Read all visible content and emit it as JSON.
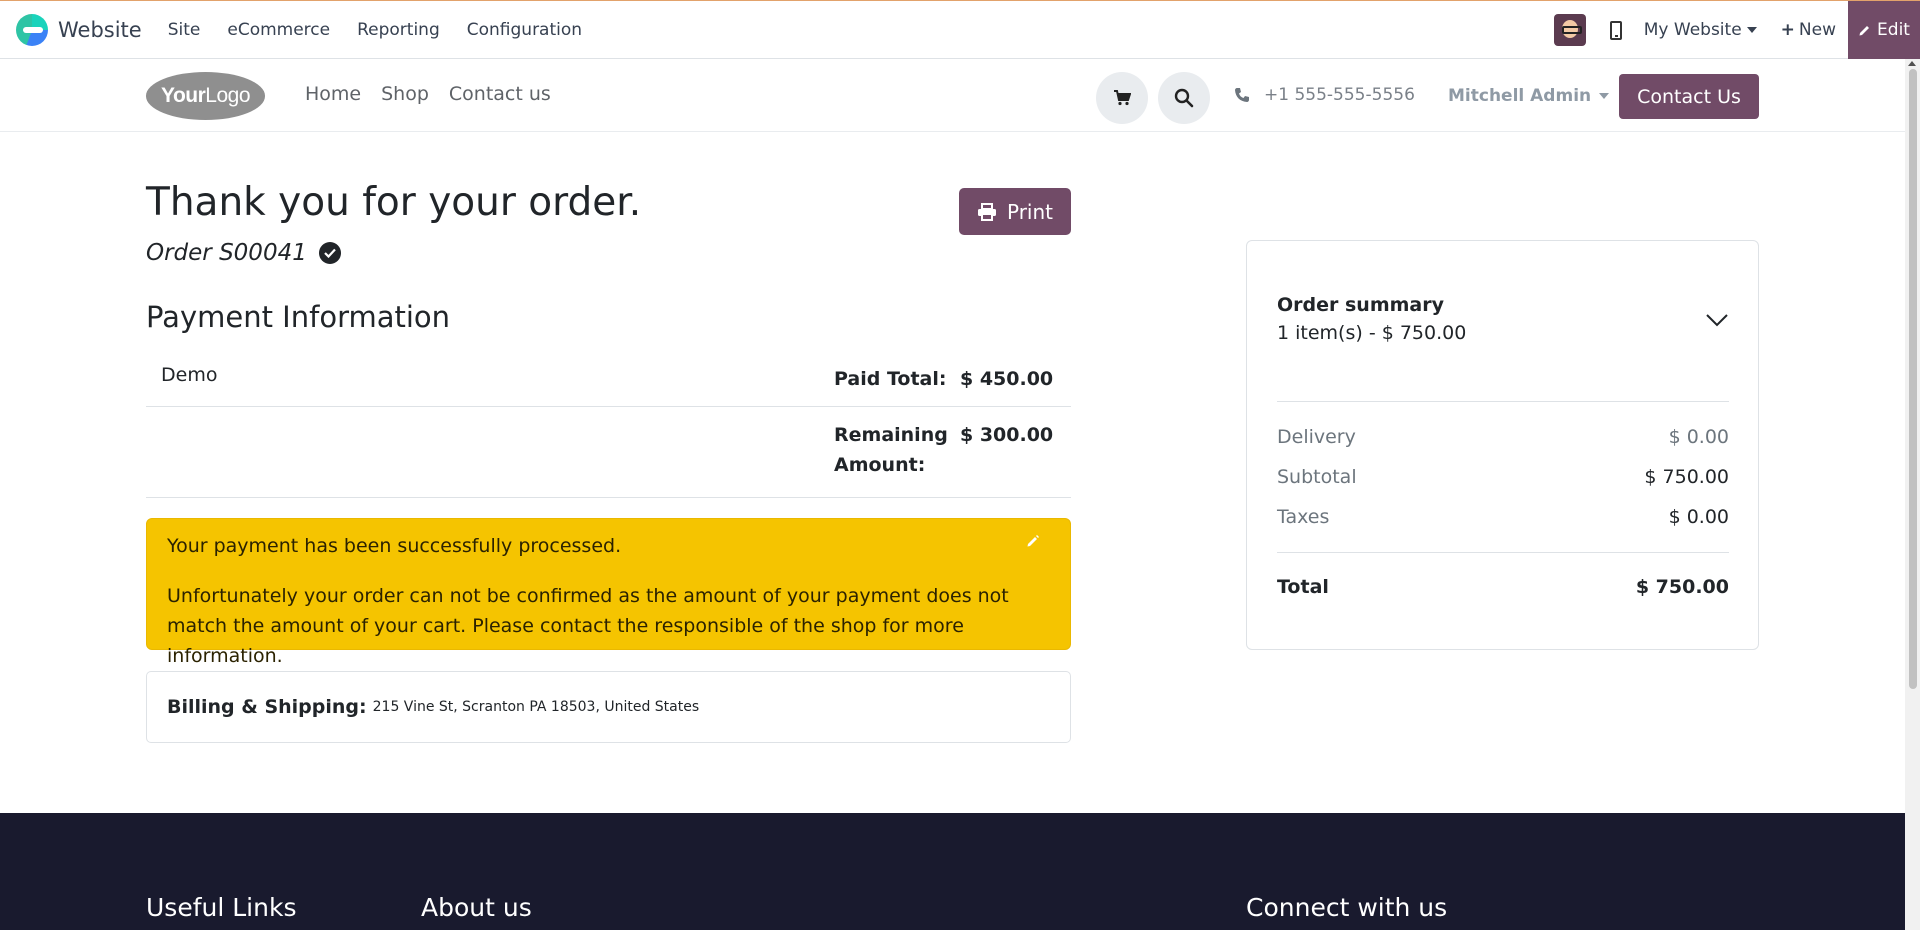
{
  "adminbar": {
    "app_name": "Website",
    "menu": [
      "Site",
      "eCommerce",
      "Reporting",
      "Configuration"
    ],
    "website_switcher": "My Website",
    "new_label": "New",
    "edit_label": "Edit"
  },
  "header": {
    "logo_text_bold": "Your",
    "logo_text_rest": "Logo",
    "nav": [
      "Home",
      "Shop",
      "Contact us"
    ],
    "phone": "+1 555-555-5556",
    "user": "Mitchell Admin",
    "contact_button": "Contact Us"
  },
  "main": {
    "title": "Thank you for your order.",
    "order_ref": "Order S00041",
    "print_label": "Print",
    "payment_heading": "Payment Information",
    "payments": [
      {
        "method": "Demo",
        "label": "Paid Total:",
        "amount": "$ 450.00"
      },
      {
        "method": "",
        "label": "Remaining Amount:",
        "amount": "$ 300.00"
      }
    ],
    "alert": {
      "line1": "Your payment has been successfully processed.",
      "line2": "Unfortunately your order can not be confirmed as the amount of your payment does not match the amount of your cart. Please contact the responsible of the shop for more information."
    },
    "billing": {
      "label": "Billing & Shipping:",
      "address": "215 Vine St, Scranton PA 18503, United States"
    }
  },
  "summary": {
    "title": "Order summary",
    "items_text": "1 item(s) -  $ 750.00",
    "lines": [
      {
        "label": "Delivery",
        "value": "$ 0.00"
      },
      {
        "label": "Subtotal",
        "value": "$ 750.00"
      },
      {
        "label": "Taxes",
        "value": "$ 0.00"
      }
    ],
    "total_label": "Total",
    "total_value": "$ 750.00"
  },
  "footer": {
    "headings": [
      "Useful Links",
      "About us",
      "Connect with us"
    ]
  },
  "colors": {
    "brand_purple": "#714b67",
    "alert_yellow": "#f5c400",
    "footer_bg": "#191a2e"
  }
}
